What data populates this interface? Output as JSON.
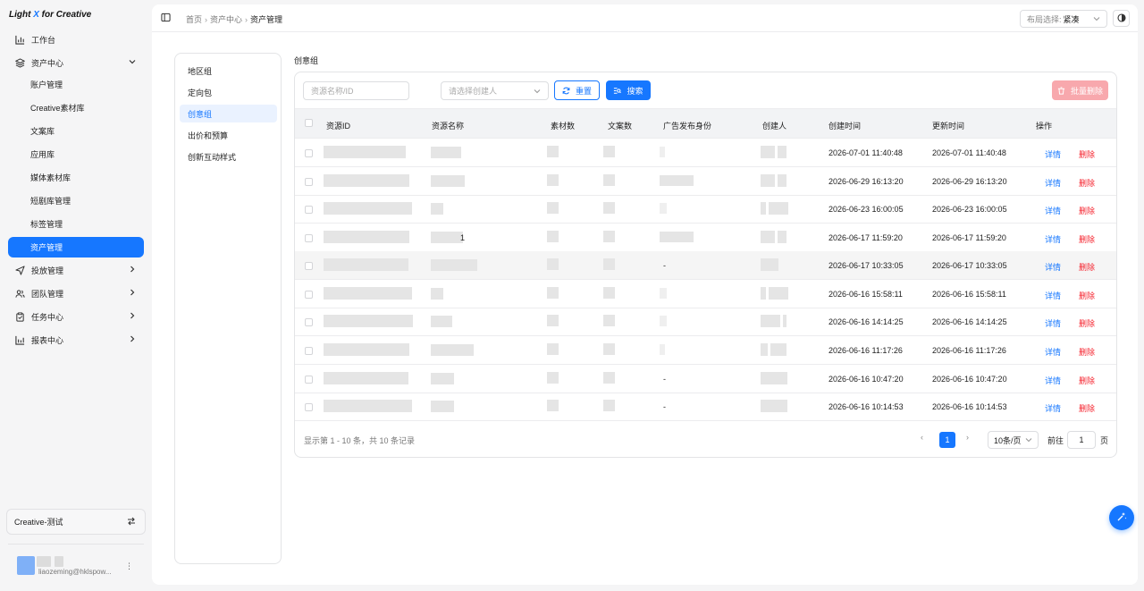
{
  "app": {
    "logo_light": "Light",
    "logo_x": "X",
    "logo_rest": "for Creative"
  },
  "sidebar": {
    "workbench": "工作台",
    "asset_center": "资产中心",
    "asset_children": [
      "账户管理",
      "Creative素材库",
      "文案库",
      "应用库",
      "媒体素材库",
      "短剧库管理",
      "标签管理",
      "资产管理"
    ],
    "delivery": "投放管理",
    "team": "团队管理",
    "task": "任务中心",
    "report": "报表中心"
  },
  "org": {
    "name": "Creative-测试"
  },
  "user": {
    "email": "liaozeming@hklspow..."
  },
  "breadcrumb": {
    "home": "首页",
    "center": "资产中心",
    "current": "资产管理"
  },
  "layout_select": {
    "label": "布局选择:",
    "value": "紧凑"
  },
  "left_panel": {
    "items": [
      "地区组",
      "定向包",
      "创意组",
      "出价和预算",
      "创新互动样式"
    ]
  },
  "section_title": "创意组",
  "filters": {
    "name_placeholder": "资源名称/ID",
    "creator_placeholder": "请选择创建人",
    "reset_label": "重置",
    "search_label": "搜索",
    "batch_delete_label": "批量删除"
  },
  "table": {
    "headers": [
      "资源ID",
      "资源名称",
      "素材数",
      "文案数",
      "广告发布身份",
      "创建人",
      "创建时间",
      "更新时间",
      "操作"
    ],
    "action_detail": "详情",
    "action_delete": "删除",
    "rows": [
      {
        "name_tail": "",
        "identity": "",
        "created": "2026-07-01 11:40:48",
        "updated": "2026-07-01 11:40:48"
      },
      {
        "name_tail": "",
        "identity": "",
        "created": "2026-06-29 16:13:20",
        "updated": "2026-06-29 16:13:20"
      },
      {
        "name_tail": "",
        "identity": "",
        "created": "2026-06-23 16:00:05",
        "updated": "2026-06-23 16:00:05"
      },
      {
        "name_tail": "1",
        "identity": "",
        "created": "2026-06-17 11:59:20",
        "updated": "2026-06-17 11:59:20"
      },
      {
        "name_tail": "",
        "identity": "-",
        "created": "2026-06-17 10:33:05",
        "updated": "2026-06-17 10:33:05"
      },
      {
        "name_tail": "",
        "identity": "",
        "created": "2026-06-16 15:58:11",
        "updated": "2026-06-16 15:58:11"
      },
      {
        "name_tail": "",
        "identity": "",
        "created": "2026-06-16 14:14:25",
        "updated": "2026-06-16 14:14:25"
      },
      {
        "name_tail": "",
        "identity": "",
        "created": "2026-06-16 11:17:26",
        "updated": "2026-06-16 11:17:26"
      },
      {
        "name_tail": "",
        "identity": "-",
        "created": "2026-06-16 10:47:20",
        "updated": "2026-06-16 10:47:20"
      },
      {
        "name_tail": "",
        "identity": "-",
        "created": "2026-06-16 10:14:53",
        "updated": "2026-06-16 10:14:53"
      }
    ]
  },
  "pagination": {
    "info": "显示第 1 - 10 条，共 10 条记录",
    "current_page": "1",
    "page_size": "10条/页",
    "goto_label": "前往",
    "goto_value": "1",
    "page_label": "页"
  },
  "colors": {
    "primary": "#1677ff",
    "danger": "#f5222d",
    "danger_disabled": "#f8a8ad"
  }
}
